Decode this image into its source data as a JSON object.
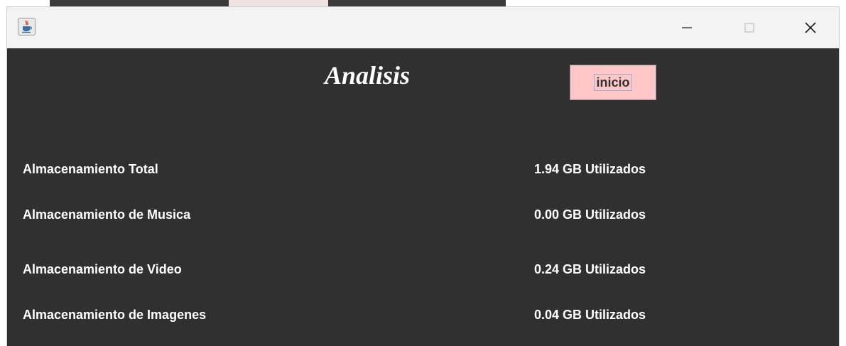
{
  "window": {
    "controls": {
      "minimize": "minimize-icon",
      "maximize": "maximize-icon",
      "close": "close-icon"
    },
    "app_icon": "java-cup-icon"
  },
  "main": {
    "title": "Analisis",
    "inicio_label": "inicio",
    "rows": [
      {
        "label": "Almacenamiento Total",
        "value": "1.94 GB Utilizados"
      },
      {
        "label": "Almacenamiento de Musica",
        "value": "0.00 GB Utilizados"
      },
      {
        "label": "Almacenamiento de Video",
        "value": "0.24 GB Utilizados"
      },
      {
        "label": "Almacenamiento de Imagenes",
        "value": "0.04 GB Utilizados"
      }
    ]
  },
  "colors": {
    "background": "#303030",
    "button": "#ffc7c7",
    "text": "#ffffff"
  }
}
